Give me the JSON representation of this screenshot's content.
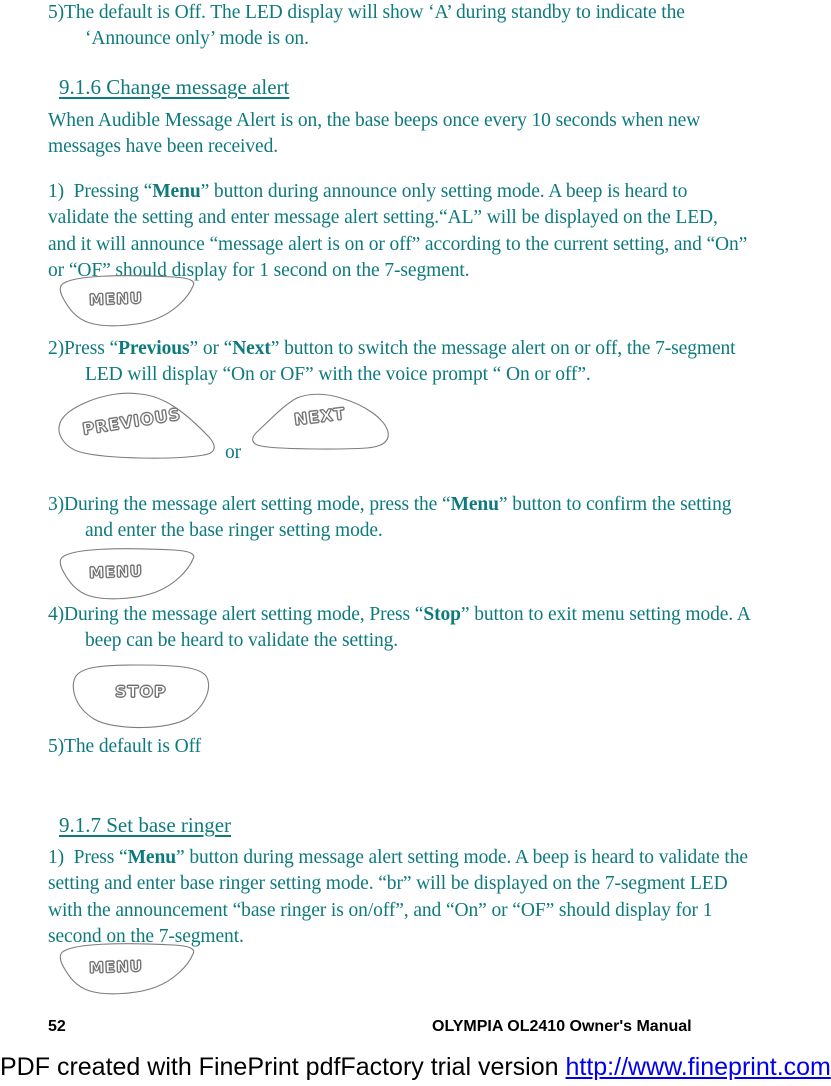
{
  "document": {
    "colors": {
      "body_text": "#0e7a7e",
      "footer_text": "#000000",
      "link": "#0000ee",
      "key_outline": "#6e6e6e",
      "page_background": "#ffffff"
    }
  },
  "content": {
    "item_5_prev_section": {
      "number": "5)",
      "text": "The default is Off. The LED display will show ‘A’ during standby to indicate the ‘Announce only’ mode is on."
    },
    "section_916": {
      "heading": "9.1.6 Change message alert",
      "intro": "When Audible Message Alert is on, the base beeps once every 10 seconds when new messages have been received.",
      "step1": {
        "number": "1)",
        "pre": "Pressing “",
        "bold": "Menu",
        "post": "” button during announce only setting mode. A beep is heard to validate the setting and enter message alert setting.“AL” will be displayed on the LED, and it will announce “message alert is on or off” according to the current setting, and “On” or “OF” should display for 1 second on the 7-segment."
      },
      "step2": {
        "number": "2)",
        "pre": "Press “",
        "bold1": "Previous",
        "mid": "” or “",
        "bold2": "Next",
        "post": "” button to switch the message alert on or off, the 7-segment LED will display “On or OF” with the voice prompt “ On or off”."
      },
      "step3": {
        "number": "3)",
        "pre": "During the message alert setting mode, press the “",
        "bold": "Menu",
        "post": "” button to confirm the setting and enter the base ringer setting mode."
      },
      "step4": {
        "number": "4)",
        "pre": "During the message alert setting mode, Press “",
        "bold": "Stop",
        "post": "” button to exit menu setting mode. A beep can be heard to validate the setting."
      },
      "step5": {
        "number": "5)",
        "text": "The default is Off"
      }
    },
    "section_917": {
      "heading": "9.1.7 Set base ringer",
      "step1": {
        "number": "1)",
        "pre": "Press “",
        "bold": "Menu",
        "post": "” button during message alert setting mode. A beep is heard to validate the setting and enter base ringer setting mode. “br” will be displayed on the 7-segment LED with the announcement  “base ringer is on/off”, and  “On” or “OF” should display for 1 second on the 7-segment."
      }
    },
    "or_connector": "or"
  },
  "keys": {
    "menu": "MENU",
    "previous": "PREVIOUS",
    "next": "NEXT",
    "stop": "STOP"
  },
  "footer": {
    "page_number": "52",
    "manual_title": "OLYMPIA  OL2410 Owner's Manual",
    "watermark_text": "PDF created with FinePrint pdfFactory trial version ",
    "watermark_url": "http://www.fineprint.com"
  }
}
